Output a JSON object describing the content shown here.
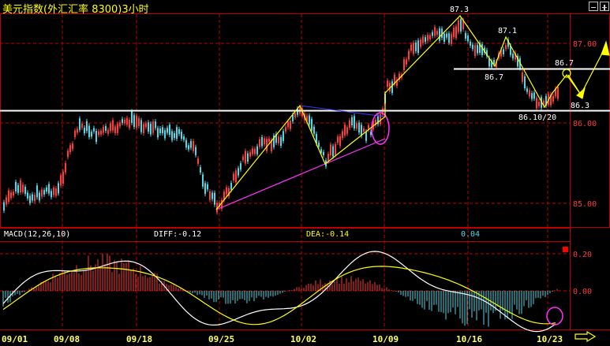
{
  "window": {
    "title": "美元指数(外汇汇率 8300)3小时"
  },
  "price_axis": {
    "labels": [
      "87.00",
      "86.00",
      "85.00"
    ]
  },
  "annotations": {
    "peak_1": "87.3",
    "peak_2": "87.1",
    "trough_1": "86.7",
    "resistance": "86.7",
    "low_label": "86.10/20",
    "target": "86.3"
  },
  "macd": {
    "name": "MACD(12,26,10)",
    "diff": "DIFF:-0.12",
    "dea": "DEA:-0.14",
    "macd_value": "0.04",
    "axis_labels": [
      "0.20",
      "0.00"
    ]
  },
  "dates": [
    "09/01",
    "09/08",
    "09/18",
    "09/25",
    "10/02",
    "10/09",
    "10/16",
    "10/23"
  ],
  "colors": {
    "up": "#ff3b3b",
    "down": "#4fd8e8",
    "title": "#ffff00",
    "trend_yellow": "#ffff00",
    "trend_magenta": "#ff33ff",
    "diff_line": "#ffffff",
    "dea_line": "#ffff00"
  },
  "icons": {
    "forward": "right-arrow-icon"
  }
}
